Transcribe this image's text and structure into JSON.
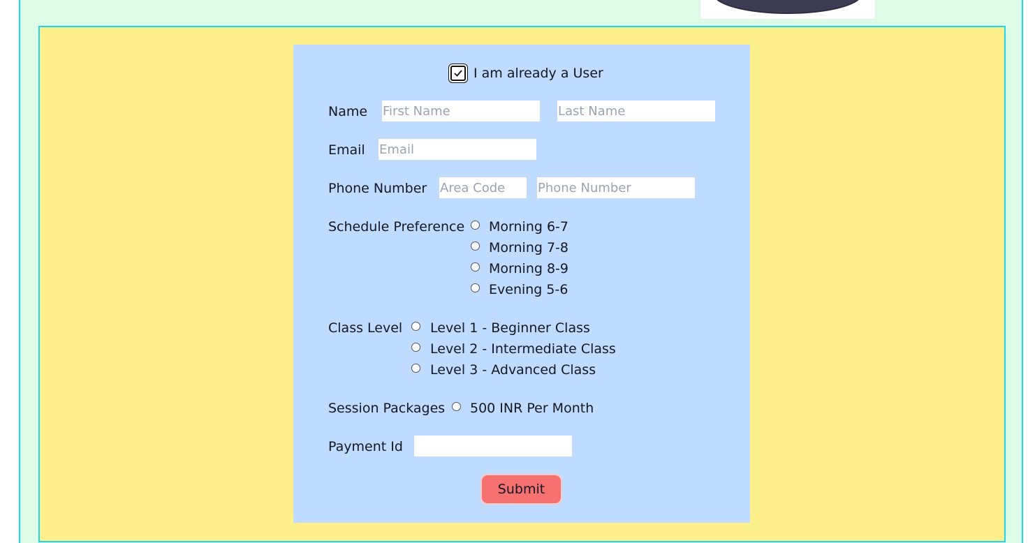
{
  "form": {
    "existing_user_label": "I am already a User",
    "existing_user_checked": true,
    "name": {
      "label": "Name",
      "first_placeholder": "First Name",
      "last_placeholder": "Last Name"
    },
    "email": {
      "label": "Email",
      "placeholder": "Email"
    },
    "phone": {
      "label": "Phone Number",
      "area_placeholder": "Area Code",
      "number_placeholder": "Phone Number"
    },
    "schedule": {
      "label": "Schedule Preference",
      "options": [
        "Morning 6-7",
        "Morning 7-8",
        "Morning 8-9",
        "Evening 5-6"
      ]
    },
    "class_level": {
      "label": "Class Level",
      "options": [
        "Level 1 - Beginner Class",
        "Level 2 - Intermediate Class",
        "Level 3 - Advanced Class"
      ]
    },
    "session": {
      "label": "Session Packages",
      "options": [
        "500 INR Per Month"
      ]
    },
    "payment": {
      "label": "Payment Id",
      "value": ""
    },
    "submit_label": "Submit"
  },
  "colors": {
    "page_bg": "#dcfce7",
    "stage_bg": "#fdf08c",
    "form_bg": "#bfdbfe",
    "accent_border": "#22d3ee",
    "submit_bg": "#f87171"
  }
}
